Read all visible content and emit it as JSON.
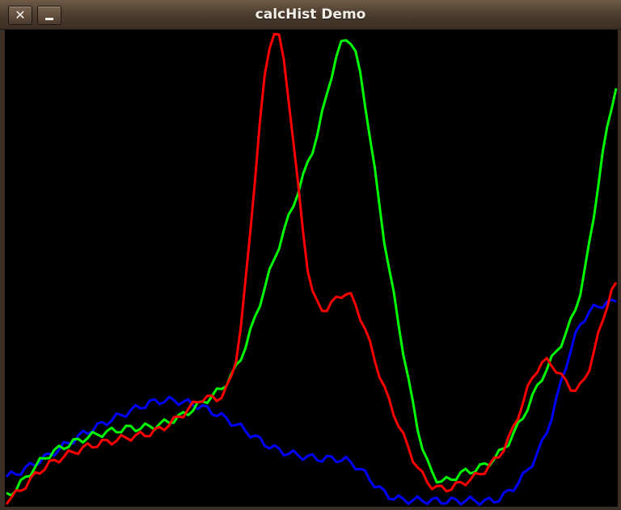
{
  "window": {
    "title": "calcHist Demo",
    "close_glyph": "✕",
    "close_icon": "close-icon",
    "minimize_icon": "minimize-icon"
  },
  "chart_data": {
    "type": "line",
    "title": "",
    "xlabel": "",
    "ylabel": "",
    "background": "#000000",
    "grid": false,
    "legend": "none",
    "xlim": [
      0,
      255
    ],
    "ylim": [
      0,
      1
    ],
    "x": [
      0,
      16,
      32,
      48,
      64,
      80,
      96,
      112,
      128,
      144,
      160,
      176,
      192,
      208,
      224,
      240,
      255
    ],
    "series": [
      {
        "color": "#0000ff",
        "values": [
          0.06,
          0.1,
          0.15,
          0.19,
          0.22,
          0.21,
          0.17,
          0.12,
          0.1,
          0.09,
          0.02,
          0.01,
          0.01,
          0.02,
          0.13,
          0.38,
          0.43
        ]
      },
      {
        "color": "#00ff00",
        "values": [
          0.02,
          0.1,
          0.14,
          0.16,
          0.17,
          0.21,
          0.29,
          0.52,
          0.75,
          0.98,
          0.5,
          0.09,
          0.07,
          0.12,
          0.27,
          0.45,
          0.88
        ]
      },
      {
        "color": "#ff0000",
        "values": [
          0.01,
          0.08,
          0.12,
          0.14,
          0.16,
          0.22,
          0.31,
          1.0,
          0.45,
          0.44,
          0.22,
          0.05,
          0.05,
          0.12,
          0.3,
          0.25,
          0.47
        ]
      }
    ]
  }
}
